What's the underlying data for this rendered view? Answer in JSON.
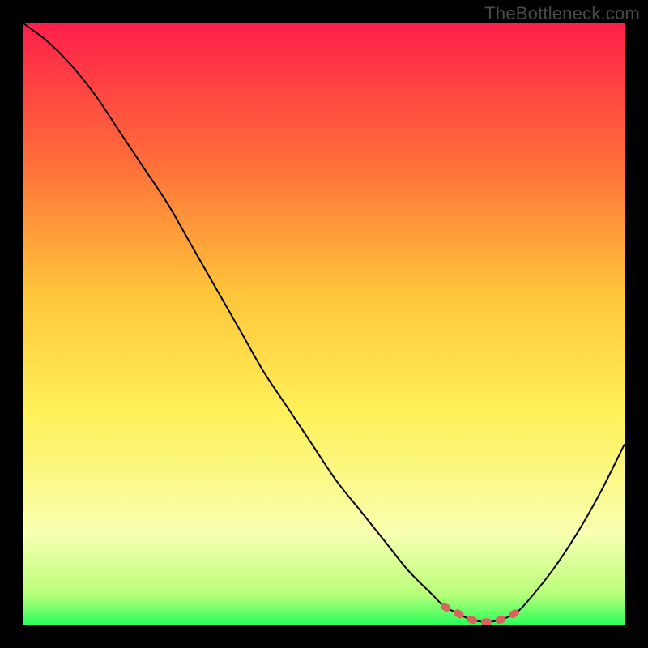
{
  "watermark": "TheBottleneck.com",
  "colors": {
    "background": "#000000",
    "gradient_top": "#ff1f4a",
    "gradient_mid_upper": "#ff7a3a",
    "gradient_mid": "#ffd23a",
    "gradient_mid_lower": "#fff95a",
    "gradient_lower": "#f8ffb0",
    "gradient_bottom": "#2cff5a",
    "curve": "#000000",
    "marker": "#d9645f"
  },
  "chart_data": {
    "type": "line",
    "title": "",
    "xlabel": "",
    "ylabel": "",
    "xlim": [
      0,
      100
    ],
    "ylim": [
      0,
      100
    ],
    "series": [
      {
        "name": "bottleneck-curve",
        "x": [
          0,
          4,
          8,
          12,
          16,
          20,
          24,
          28,
          32,
          36,
          40,
          44,
          48,
          52,
          56,
          60,
          64,
          68,
          70,
          72,
          74,
          76,
          78,
          80,
          82,
          84,
          88,
          92,
          96,
          100
        ],
        "values": [
          100,
          97,
          93,
          88,
          82,
          76,
          70,
          63,
          56,
          49,
          42,
          36,
          30,
          24,
          19,
          14,
          9,
          5,
          3,
          2,
          1,
          0.5,
          0.5,
          1,
          2,
          4,
          9,
          15,
          22,
          30
        ]
      }
    ],
    "markers": [
      {
        "name": "optimal-range",
        "x": [
          70,
          72,
          74,
          76,
          78,
          80,
          82
        ],
        "values": [
          3,
          2,
          1,
          0.5,
          0.5,
          1,
          2
        ]
      }
    ],
    "gradient_stops_pct": [
      {
        "offset": 0,
        "color": "#ff1f4a"
      },
      {
        "offset": 22,
        "color": "#ff6a3a"
      },
      {
        "offset": 45,
        "color": "#ffc53a"
      },
      {
        "offset": 65,
        "color": "#fff15a"
      },
      {
        "offset": 85,
        "color": "#f8ffb0"
      },
      {
        "offset": 95,
        "color": "#b8ff7a"
      },
      {
        "offset": 100,
        "color": "#2cff5a"
      }
    ]
  }
}
